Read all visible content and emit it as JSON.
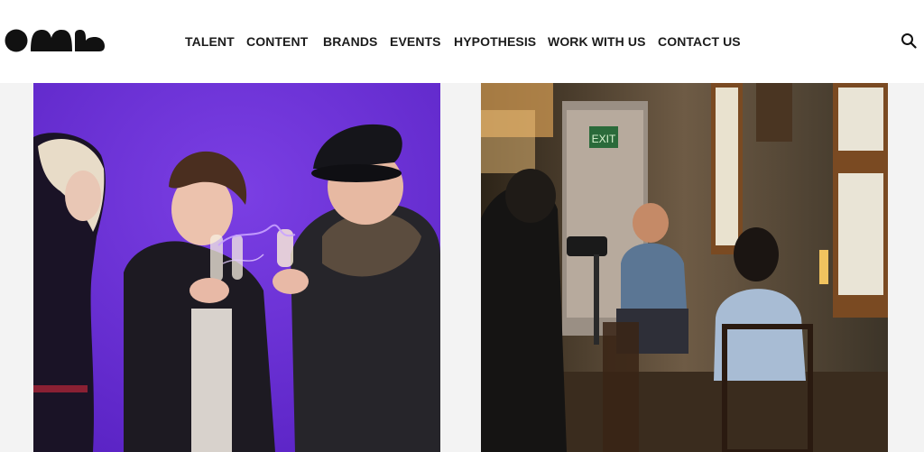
{
  "brand": {
    "logo_icon": "oml-logo",
    "logo_text": "OML"
  },
  "nav": {
    "items": [
      {
        "label": "TALENT"
      },
      {
        "label": "CONTENT"
      },
      {
        "label": "BRANDS"
      },
      {
        "label": "EVENTS"
      },
      {
        "label": "HYPOTHESIS"
      },
      {
        "label": "WORK WITH US"
      },
      {
        "label": "CONTACT US"
      }
    ]
  },
  "header": {
    "search_icon": "search-icon"
  },
  "gallery": {
    "tiles": [
      {
        "image": "three-people-toasting-champagne-purple-backdrop",
        "accent": "#6b2fd6"
      },
      {
        "image": "film-crew-interview-in-wooden-room",
        "accent": "#b9823e"
      }
    ],
    "exit_sign": "EXIT"
  },
  "colors": {
    "header_bg": "#ffffff",
    "page_bg": "#f3f3f3",
    "nav_text": "#1c1c1c"
  }
}
